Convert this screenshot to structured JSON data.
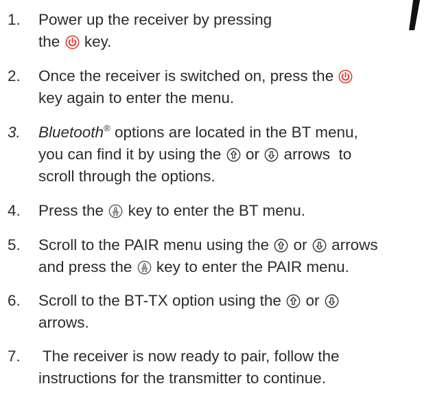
{
  "colors": {
    "text": "#2b2b2b",
    "power_icon": "#e4332a",
    "arrow_icon": "#2b2b2b",
    "menu_icon": "#555555"
  },
  "icons": {
    "power": "power-icon",
    "up": "up-arrow-icon",
    "down": "down-arrow-icon",
    "menu": "menu-select-icon"
  },
  "steps": [
    {
      "num": "1.",
      "line1_a": "Power up the receiver by pressing",
      "line2_a": "the",
      "line2_b": "key."
    },
    {
      "num": "2.",
      "line1_a": "Once the receiver is switched on, press the",
      "line2_a": "key again to enter the menu."
    },
    {
      "num": "3.",
      "line1_brand": "Bluetooth",
      "line1_reg": "®",
      "line1_a": "options are located in the BT menu,",
      "line2_a": "you can find it by using the",
      "line2_b": "or",
      "line2_c": "arrows  to",
      "line3_a": "scroll through the options."
    },
    {
      "num": "4.",
      "line1_a": "Press the",
      "line1_b": "key to enter the BT menu."
    },
    {
      "num": "5.",
      "line1_a": "Scroll to the PAIR menu using the",
      "line1_b": "or",
      "line1_c": "arrows",
      "line2_a": "and press the",
      "line2_b": "key to enter the PAIR menu."
    },
    {
      "num": "6.",
      "line1_a": "Scroll to the BT-TX option using the",
      "line1_b": "or",
      "line2_a": "arrows."
    },
    {
      "num": "7.",
      "line1_a": " The receiver is now ready to pair, follow the",
      "line2_a": "instructions for the transmitter to continue."
    }
  ]
}
